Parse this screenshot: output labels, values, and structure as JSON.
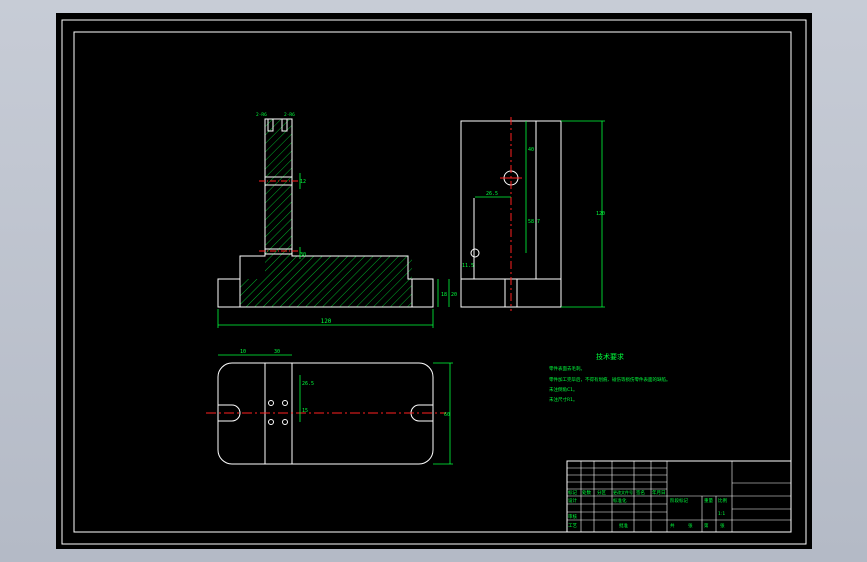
{
  "colors": {
    "background": "#000000",
    "outline": "#ffffff",
    "centerline": "#ff2020",
    "dimension": "#00ff3c",
    "hatch": "#00ff3c",
    "window": "#c0c6d0"
  },
  "front_view": {
    "dims": {
      "slot_top_left": "2-R6",
      "slot_top_right": "2-R6",
      "upright_gap": "12",
      "upright_lower": "30",
      "base_height": "18",
      "base_total": "20",
      "overall_width": "120"
    }
  },
  "side_view": {
    "dims": {
      "hole_top": "40",
      "hole_offset_a": "26.5",
      "hole_offset_b": "58.7",
      "small_hole": "11.5",
      "overall_height": "120"
    }
  },
  "plan_view": {
    "dims": {
      "left_edge": "10",
      "hole_spacing": "30",
      "vertical_a": "26.5",
      "vertical_b": "15",
      "overall_height": "60"
    }
  },
  "tech_requirements": {
    "title": "技术要求",
    "lines": [
      "零件表面去毛刺。",
      "零件加工完毕后，不得有划痕、碰伤等损伤零件表面的缺陷。",
      "未注倒角C1。",
      "未注尺寸R1。"
    ]
  },
  "title_block": {
    "labels": {
      "mark": "标记",
      "count": "处数",
      "zone": "分区",
      "change_doc": "更改文件号",
      "sign": "签名",
      "date": "年月日",
      "design": "设计",
      "standardize": "标准化",
      "review": "审核",
      "process": "工艺",
      "approve": "批准",
      "stage_mark": "阶段标记",
      "weight": "重量",
      "scale": "比例",
      "scale_value": "1:1",
      "sheet_total": "共",
      "sheet_no": "张",
      "sheet_of": "第",
      "sheet_unit": "张"
    }
  }
}
